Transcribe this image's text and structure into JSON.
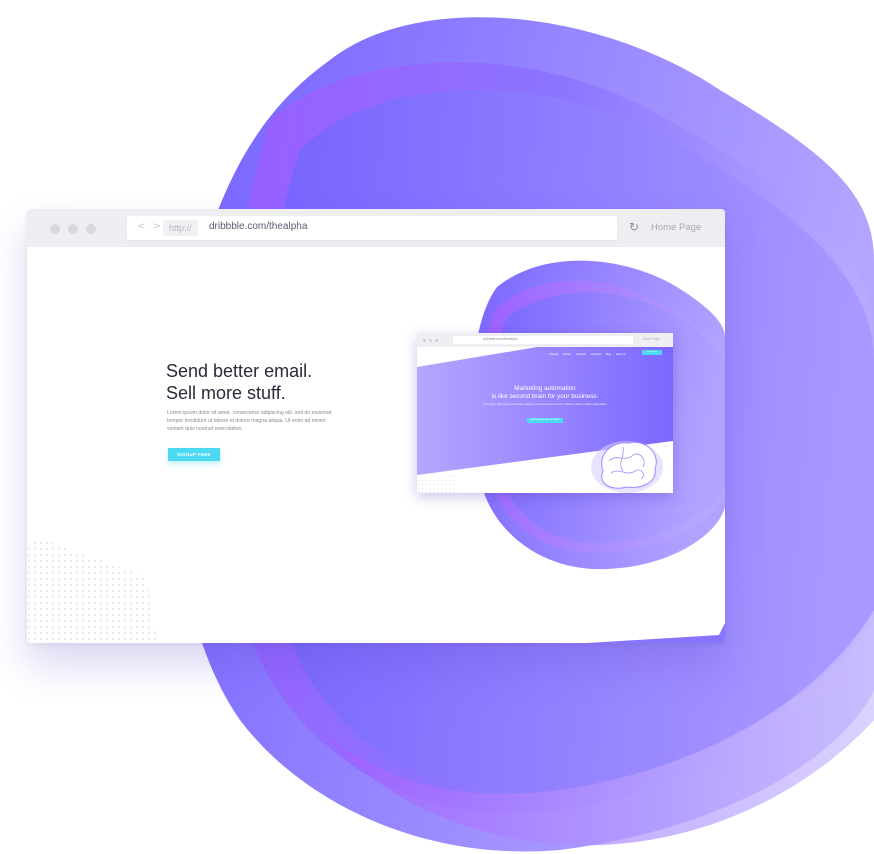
{
  "browser": {
    "url_protocol": "http://",
    "url": "dribbble.com/thealpha",
    "nav_arrows": "< >",
    "reload_icon": "↻",
    "home_label": "Home Page"
  },
  "hero": {
    "headline_line1": "Send better email.",
    "headline_line2": "Sell more stuff.",
    "body": "Lorem ipsum dolor sit amet, consectetur adipiscing elit, sed do eiusmod tempor incididunt ut labore et dolore magna aliqua. Ut enim ad minim veniam quis nostrud exercitation.",
    "cta_label": "SIGNUP FREE"
  },
  "mini_browser": {
    "url": "dribbble.com/thealpha",
    "home_label": "Home Page",
    "nav_items": [
      "Strategic",
      "Results",
      "Channels",
      "Industries",
      "Blog",
      "About Us"
    ],
    "nav_button": "Free Trial",
    "title_line1": "Marketing automation",
    "title_line2": "is like second brain for your business.",
    "subtitle": "Lorem ipsum dolor sit amet consectetur adipiscing elit sed do eiusmod tempor incididunt ut labore et dolore magna aliqua.",
    "cta_label": "LEARN MORE ABOUT BRAIN"
  },
  "colors": {
    "accent": "#4dd9f2",
    "purple_dark": "#7b66ff",
    "purple_light": "#b3a3ff",
    "purple_magenta": "#a36bff"
  }
}
